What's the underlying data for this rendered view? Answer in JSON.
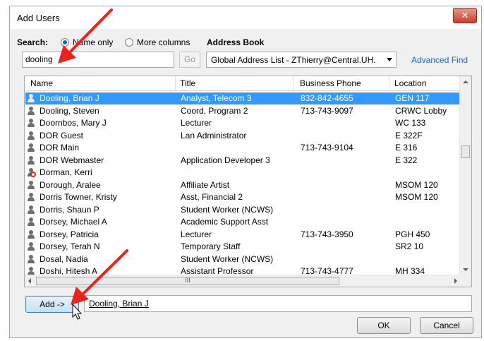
{
  "window": {
    "title": "Add Users",
    "close_glyph": "✕"
  },
  "search": {
    "label": "Search:",
    "name_only_label": "Name only",
    "more_columns_label": "More columns",
    "value": "dooling",
    "go_label": "Go"
  },
  "address_book": {
    "label": "Address Book",
    "selected": "Global Address List - ZThierry@Central.UH.",
    "advanced_find_label": "Advanced Find"
  },
  "table": {
    "headers": [
      "Name",
      "Title",
      "Business Phone",
      "Location"
    ],
    "rows": [
      {
        "name": "Dooling, Brian J",
        "title": "Analyst, Telecom 3",
        "phone": "832-842-4655",
        "location": "GEN 117",
        "icon": "person-icon",
        "selected": true
      },
      {
        "name": "Dooling, Steven",
        "title": "Coord, Program 2",
        "phone": "713-743-9097",
        "location": "CRWC Lobby",
        "icon": "person-icon"
      },
      {
        "name": "Doornbos, Mary J",
        "title": "Lecturer",
        "phone": "",
        "location": "WC 133",
        "icon": "person-icon"
      },
      {
        "name": "DOR Guest",
        "title": "Lan Administrator",
        "phone": "",
        "location": "E 322F",
        "icon": "person-icon"
      },
      {
        "name": "DOR Main",
        "title": "",
        "phone": "713-743-9104",
        "location": "E 316",
        "icon": "person-icon"
      },
      {
        "name": "DOR Webmaster",
        "title": "Application Developer 3",
        "phone": "",
        "location": "E 322",
        "icon": "person-icon"
      },
      {
        "name": "Dorman, Kerri",
        "title": "",
        "phone": "",
        "location": "",
        "icon": "person-disabled-icon"
      },
      {
        "name": "Dorough, Aralee",
        "title": "Affiliate Artist",
        "phone": "",
        "location": "MSOM 120",
        "icon": "person-icon"
      },
      {
        "name": "Dorris Towner, Kristy",
        "title": "Asst, Financial 2",
        "phone": "",
        "location": "MSOM 120",
        "icon": "person-icon"
      },
      {
        "name": "Dorris, Shaun P",
        "title": "Student Worker (NCWS)",
        "phone": "",
        "location": "",
        "icon": "person-icon"
      },
      {
        "name": "Dorsey, Michael A",
        "title": "Academic Support Asst",
        "phone": "",
        "location": "",
        "icon": "person-icon"
      },
      {
        "name": "Dorsey, Patricia",
        "title": "Lecturer",
        "phone": "713-743-3950",
        "location": "PGH 450",
        "icon": "person-icon"
      },
      {
        "name": "Dorsey, Terah N",
        "title": "Temporary Staff",
        "phone": "",
        "location": "SR2 10",
        "icon": "person-icon"
      },
      {
        "name": "Dosal, Nadia",
        "title": "Student Worker (NCWS)",
        "phone": "",
        "location": "",
        "icon": "person-icon"
      },
      {
        "name": "Doshi, Hitesh A",
        "title": "Assistant Professor",
        "phone": "713-743-4777",
        "location": "MH 334",
        "icon": "person-icon"
      }
    ]
  },
  "scrollbar": {
    "grip": "III"
  },
  "add": {
    "button_label": "Add ->",
    "selected_value": "Dooling, Brian J"
  },
  "buttons": {
    "ok_label": "OK",
    "cancel_label": "Cancel"
  },
  "colors": {
    "selection": "#3399ff",
    "link": "#1a64c8",
    "annotation_arrow": "#e8231e"
  }
}
